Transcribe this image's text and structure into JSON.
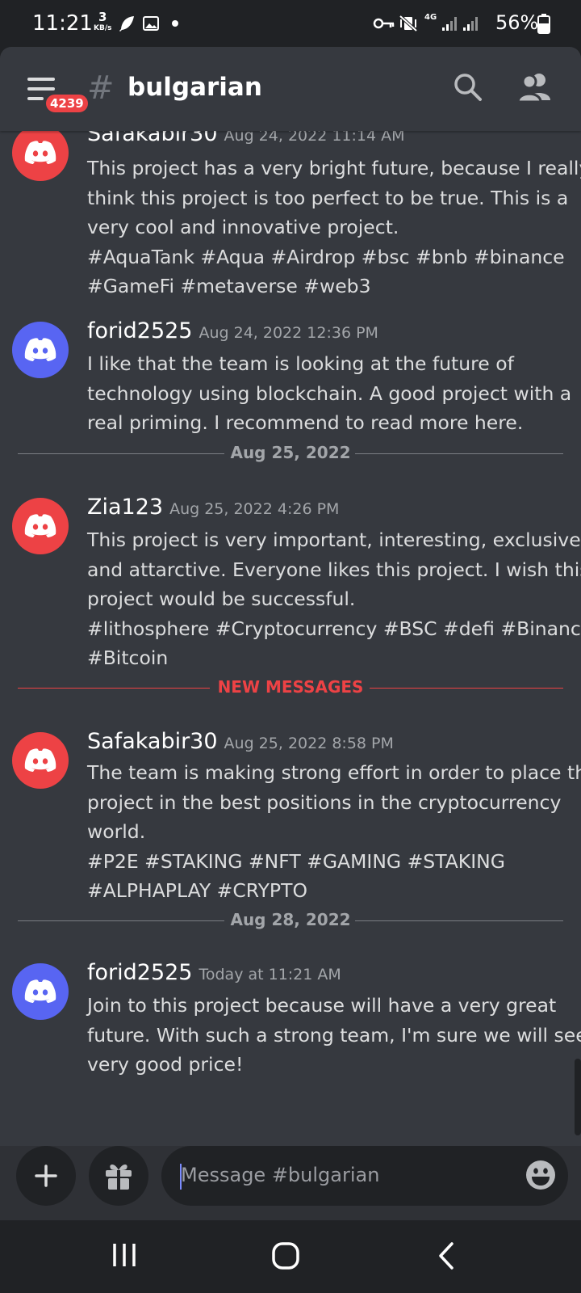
{
  "status_bar": {
    "time": "11:21",
    "net_speed_value": "3",
    "net_speed_unit": "KB/s",
    "network_type": "4G",
    "battery": "56%"
  },
  "header": {
    "notification_count": "4239",
    "hash_symbol": "#",
    "channel_name": "bulgarian"
  },
  "messages": [
    {
      "username": "Safakabir30",
      "timestamp": "Aug 24, 2022 11:14 AM",
      "avatar_color": "#ed4245",
      "lines": [
        "This project has a very bright future, because I really",
        "think this project is too perfect to be true. This is a",
        "very cool and innovative project.",
        "#AquaTank #Aqua #Airdrop #bsc #bnb #binance",
        "#GameFi #metaverse #web3"
      ]
    },
    {
      "username": "forid2525",
      "timestamp": "Aug 24, 2022 12:36 PM",
      "avatar_color": "#5865f2",
      "lines": [
        "I like that the team is looking at the future of",
        "technology using blockchain. A good project with a",
        "real priming. I recommend to read more here."
      ]
    },
    {
      "username": "Zia123",
      "timestamp": "Aug 25, 2022 4:26 PM",
      "avatar_color": "#ed4245",
      "lines": [
        "This project is very important, interesting, exclusive",
        "and attarctive. Everyone likes this project. I wish this",
        "project would be successful.",
        "#lithosphere #Cryptocurrency #BSC #defi #Binance",
        "#Bitcoin"
      ]
    },
    {
      "username": "Safakabir30",
      "timestamp": "Aug 25, 2022 8:58 PM",
      "avatar_color": "#ed4245",
      "lines": [
        "The team is making  strong effort in order to place the",
        "project in the best positions in the cryptocurrency",
        "world.",
        "#P2E #STAKING #NFT #GAMING #STAKING",
        "#ALPHAPLAY #CRYPTO"
      ]
    },
    {
      "username": "forid2525",
      "timestamp": "Today at 11:21 AM",
      "avatar_color": "#5865f2",
      "lines": [
        "Join to this project because will have a very great",
        "future. With such a strong team, I'm sure we will see a",
        "very good price!"
      ]
    }
  ],
  "dividers": {
    "date_1": "Aug 25, 2022",
    "new_messages": "NEW MESSAGES",
    "date_2": "Aug 28, 2022"
  },
  "composer": {
    "placeholder": "Message #bulgarian"
  },
  "colors": {
    "background": "#36393f",
    "dark": "#202225",
    "red_accent": "#ed4245",
    "blurple": "#5865f2"
  }
}
